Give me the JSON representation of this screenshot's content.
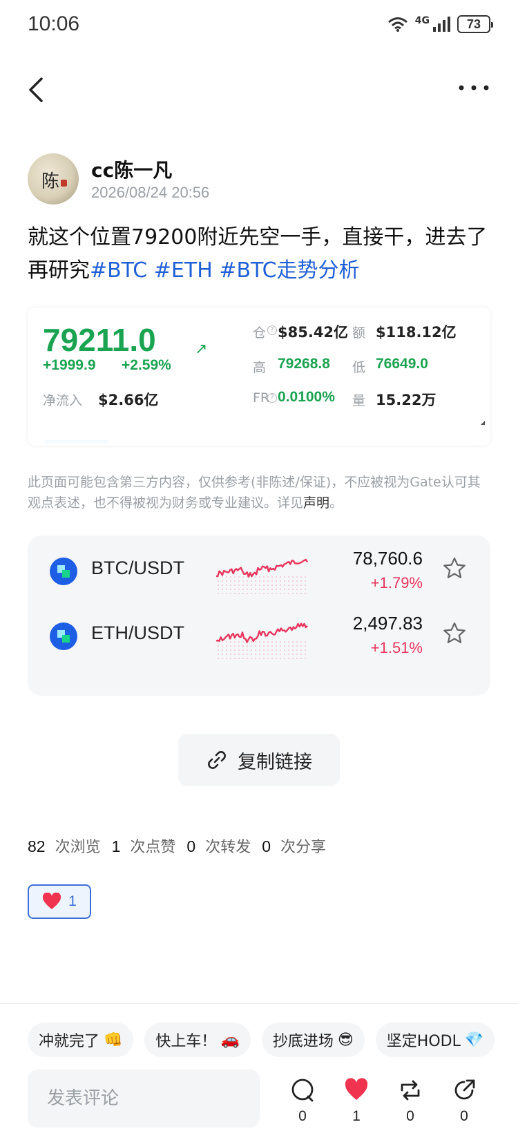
{
  "status_bar": {
    "time": "10:06",
    "network": "4G",
    "battery": "73"
  },
  "nav": {
    "back_icon": "chevron-left-icon",
    "more_icon": "more-dots-icon"
  },
  "author": {
    "name": "cc陈一凡",
    "time": "2026/08/24 20:56",
    "avatar_glyph": "陈"
  },
  "post": {
    "text": "就这个位置79200附近先空一手，直接干，进去了再研究",
    "tags": [
      "#BTC",
      "#ETH",
      "#BTC走势分析"
    ]
  },
  "ticker": {
    "price": "79211.0",
    "change_abs": "+1999.9",
    "change_pct": "+2.59%",
    "net_inflow_label": "净流入",
    "net_inflow": "$2.66亿",
    "oi_label": "仓",
    "oi": "$85.42亿",
    "volume_amt_label": "额",
    "volume_amt": "$118.12亿",
    "high_label": "高",
    "high": "79268.8",
    "low_label": "低",
    "low": "76649.0",
    "fr_label": "FR",
    "fr": "0.0100%",
    "vol_label": "量",
    "vol": "15.22万",
    "colors": {
      "up": "#1aa351"
    }
  },
  "disclaimer": {
    "text": "此页面可能包含第三方内容，仅供参考(非陈述/保证)，不应被视为Gate认可其观点表述，也不得被视为财务或专业建议。详见",
    "link": "声明",
    "end": "。"
  },
  "markets": [
    {
      "pair": "BTC/USDT",
      "price": "78,760.6",
      "change": "+1.79%"
    },
    {
      "pair": "ETH/USDT",
      "price": "2,497.83",
      "change": "+1.51%"
    }
  ],
  "copy_link": {
    "label": "复制链接",
    "icon": "link-icon"
  },
  "stats": [
    {
      "num": "82",
      "label": "次浏览"
    },
    {
      "num": "1",
      "label": "次点赞"
    },
    {
      "num": "0",
      "label": "次转发"
    },
    {
      "num": "0",
      "label": "次分享"
    }
  ],
  "like_chip": {
    "count": "1",
    "icon": "heart-icon"
  },
  "quick_replies": [
    {
      "label": "冲就完了",
      "emoji": "👊"
    },
    {
      "label": "快上车！",
      "emoji": "🚗"
    },
    {
      "label": "抄底进场",
      "emoji": "😎"
    },
    {
      "label": "坚定HODL",
      "emoji": "💎"
    }
  ],
  "comment": {
    "placeholder": "发表评论"
  },
  "actions": [
    {
      "name": "comment",
      "icon": "comment-icon",
      "count": "0"
    },
    {
      "name": "like",
      "icon": "heart-icon",
      "count": "1"
    },
    {
      "name": "repost",
      "icon": "repost-icon",
      "count": "0"
    },
    {
      "name": "share",
      "icon": "share-icon",
      "count": "0"
    }
  ],
  "accent_colors": {
    "link": "#1f5fd6",
    "down_red": "#e8355c",
    "heart": "#f0344f",
    "brand_blue": "#1e5ee4"
  }
}
